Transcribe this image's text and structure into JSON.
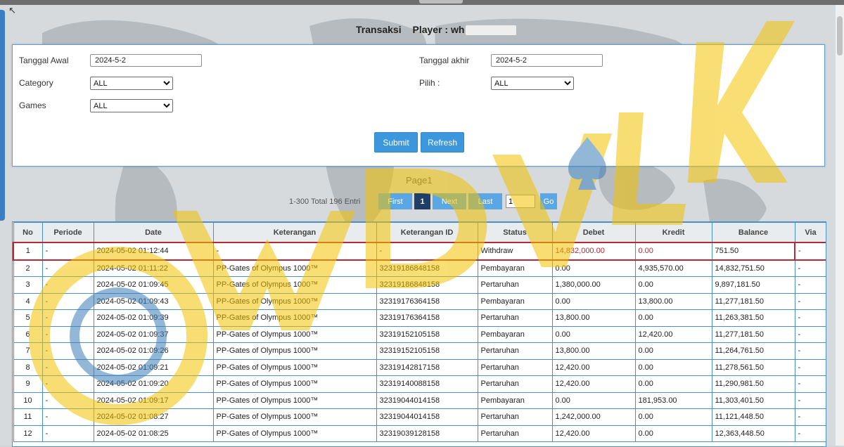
{
  "header": {
    "title": "Transaksi",
    "player_label": "Player : wh"
  },
  "filters": {
    "tanggal_awal_label": "Tanggal Awal",
    "tanggal_awal_value": "2024-5-2",
    "tanggal_akhir_label": "Tanggal akhir",
    "tanggal_akhir_value": "2024-5-2",
    "category_label": "Category",
    "category_value": "ALL",
    "pilih_label": "Pilih  :",
    "pilih_value": "ALL",
    "games_label": "Games",
    "games_value": "ALL",
    "submit_label": "Submit",
    "refresh_label": "Refresh"
  },
  "pagination": {
    "page_title": "Page1",
    "info": "1-300 Total 196 Entri",
    "first_label": "First",
    "current_page": "1",
    "next_label": "Next",
    "last_label": "Last",
    "goto_value": "1",
    "go_label": "Go"
  },
  "table": {
    "columns": [
      "No",
      "Periode",
      "Date",
      "Keterangan",
      "Keterangan ID",
      "Status",
      "Debet",
      "Kredit",
      "Balance",
      "Via"
    ],
    "rows": [
      [
        "1",
        "-",
        "2024-05-02 01:12:44",
        "-",
        "-",
        "Withdraw",
        "14,832,000.00",
        "0.00",
        "751.50",
        "-"
      ],
      [
        "2",
        "-",
        "2024-05-02 01:11:22",
        "PP-Gates of Olympus 1000™",
        "32319186848158",
        "Pembayaran",
        "0.00",
        "4,935,570.00",
        "14,832,751.50",
        "-"
      ],
      [
        "3",
        "-",
        "2024-05-02 01:09:45",
        "PP-Gates of Olympus 1000™",
        "32319186848158",
        "Pertaruhan",
        "1,380,000.00",
        "0.00",
        "9,897,181.50",
        "-"
      ],
      [
        "4",
        "-",
        "2024-05-02 01:09:43",
        "PP-Gates of Olympus 1000™",
        "32319176364158",
        "Pembayaran",
        "0.00",
        "13,800.00",
        "11,277,181.50",
        "-"
      ],
      [
        "5",
        "-",
        "2024-05-02 01:09:39",
        "PP-Gates of Olympus 1000™",
        "32319176364158",
        "Pertaruhan",
        "13,800.00",
        "0.00",
        "11,263,381.50",
        "-"
      ],
      [
        "6",
        "-",
        "2024-05-02 01:09:37",
        "PP-Gates of Olympus 1000™",
        "32319152105158",
        "Pembayaran",
        "0.00",
        "12,420.00",
        "11,277,181.50",
        "-"
      ],
      [
        "7",
        "-",
        "2024-05-02 01:09:26",
        "PP-Gates of Olympus 1000™",
        "32319152105158",
        "Pertaruhan",
        "13,800.00",
        "0.00",
        "11,264,761.50",
        "-"
      ],
      [
        "8",
        "-",
        "2024-05-02 01:09:21",
        "PP-Gates of Olympus 1000™",
        "32319142817158",
        "Pertaruhan",
        "12,420.00",
        "0.00",
        "11,278,561.50",
        "-"
      ],
      [
        "9",
        "-",
        "2024-05-02 01:09:20",
        "PP-Gates of Olympus 1000™",
        "32319140088158",
        "Pertaruhan",
        "12,420.00",
        "0.00",
        "11,290,981.50",
        "-"
      ],
      [
        "10",
        "-",
        "2024-05-02 01:09:17",
        "PP-Gates of Olympus 1000™",
        "32319044014158",
        "Pembayaran",
        "0.00",
        "181,953.00",
        "11,303,401.50",
        "-"
      ],
      [
        "11",
        "-",
        "2024-05-02 01:08:27",
        "PP-Gates of Olympus 1000™",
        "32319044014158",
        "Pertaruhan",
        "1,242,000.00",
        "0.00",
        "11,121,448.50",
        "-"
      ],
      [
        "12",
        "-",
        "2024-05-02 01:08:25",
        "PP-Gates of Olympus 1000™",
        "32319039128158",
        "Pertaruhan",
        "12,420.00",
        "0.00",
        "12,363,448.50",
        "-"
      ]
    ],
    "highlight_color": "#b52a35"
  },
  "watermark": {
    "text": "WDVLK",
    "color": "#f2c200"
  }
}
